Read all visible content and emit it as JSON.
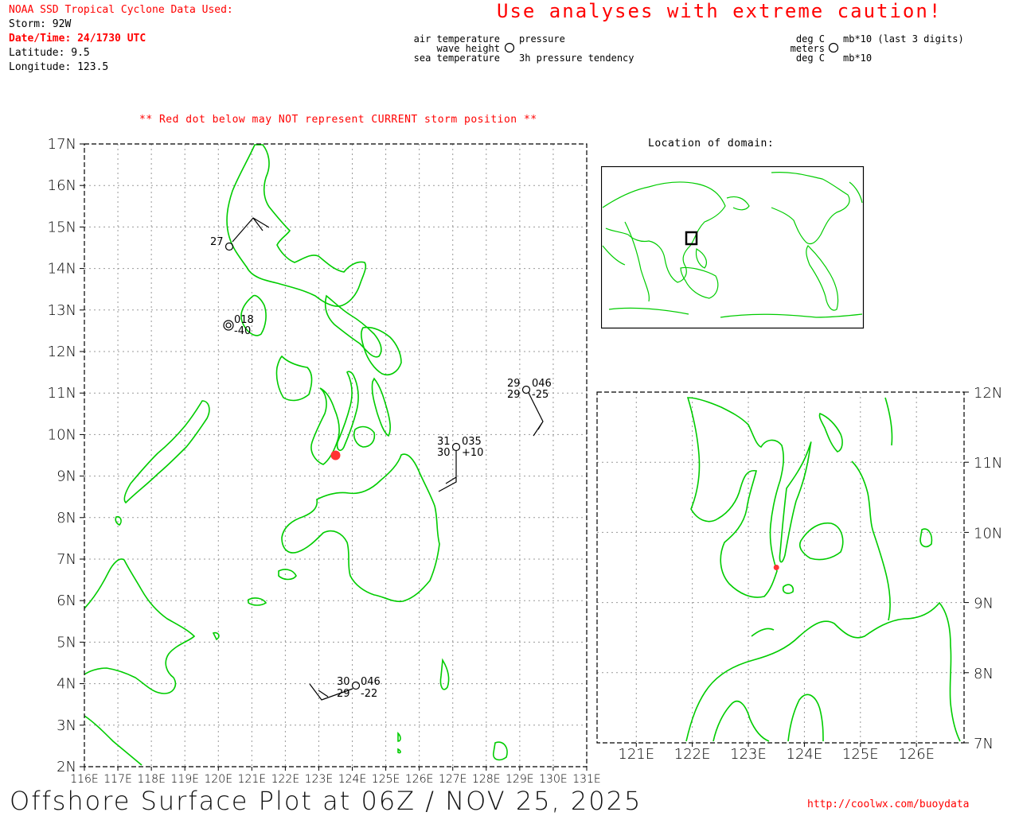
{
  "header": {
    "source_line": "NOAA SSD Tropical Cyclone Data Used:",
    "storm": "Storm: 92W",
    "datetime": "Date/Time: 24/1730 UTC",
    "latitude": "Latitude: 9.5",
    "longitude": "Longitude: 123.5",
    "warning": "Use analyses with extreme caution!"
  },
  "legend": {
    "left_top_left": "air temperature",
    "left_top_right": "pressure",
    "left_mid": "wave height",
    "left_bot_left": "sea temperature",
    "left_bot_right": "3h pressure tendency",
    "right_top_left": "deg C",
    "right_top_right": "mb*10 (last 3 digits)",
    "right_mid": "meters",
    "right_bot_left": "deg C",
    "right_bot_right": "mb*10"
  },
  "red_dot_note": "** Red dot below may NOT represent CURRENT storm position **",
  "inset_title": "Location of domain:",
  "main_map": {
    "lat_labels": [
      "17N",
      "16N",
      "15N",
      "14N",
      "13N",
      "12N",
      "11N",
      "10N",
      "9N",
      "8N",
      "7N",
      "6N",
      "5N",
      "4N",
      "3N",
      "2N"
    ],
    "lon_labels": [
      "116E",
      "117E",
      "118E",
      "119E",
      "120E",
      "121E",
      "122E",
      "123E",
      "124E",
      "125E",
      "126E",
      "127E",
      "128E",
      "129E",
      "130E",
      "131E"
    ],
    "storm_position": {
      "lat": 9.5,
      "lon": 123.5
    },
    "observations": [
      {
        "id": "obs1",
        "texts": [
          "27"
        ]
      },
      {
        "id": "obs2",
        "texts": [
          "018",
          "-40"
        ]
      },
      {
        "id": "obs3",
        "texts": [
          "29",
          "046",
          "29",
          "-25"
        ]
      },
      {
        "id": "obs4",
        "texts": [
          "31",
          "035",
          "30",
          "+10"
        ]
      },
      {
        "id": "obs5",
        "texts": [
          "30",
          "046",
          "29",
          "-22"
        ]
      }
    ]
  },
  "zoom_map": {
    "lat_labels": [
      "12N",
      "11N",
      "10N",
      "9N",
      "8N",
      "7N"
    ],
    "lon_labels": [
      "121E",
      "122E",
      "123E",
      "124E",
      "125E",
      "126E"
    ]
  },
  "colors": {
    "coast": "#00cc00",
    "storm": "#ff3333",
    "warning": "#ff0000"
  },
  "footer": {
    "title": "Offshore Surface Plot at 06Z / NOV 25, 2025",
    "url": "http://coolwx.com/buoydata"
  }
}
